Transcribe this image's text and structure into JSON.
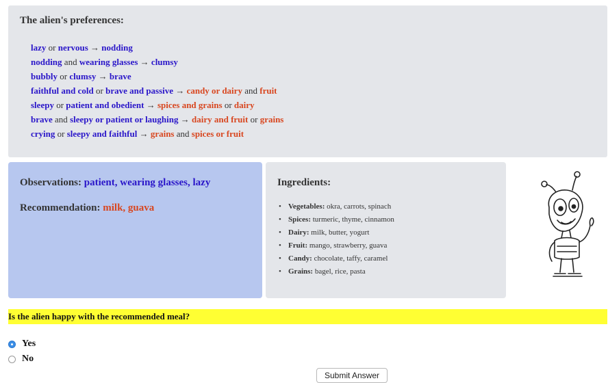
{
  "preferences": {
    "title": "The alien's preferences:",
    "rules": [
      [
        {
          "t": "lazy",
          "c": "blue"
        },
        {
          "t": " or ",
          "c": ""
        },
        {
          "t": "nervous",
          "c": "blue"
        },
        {
          "t": " → ",
          "c": ""
        },
        {
          "t": "nodding",
          "c": "blue"
        }
      ],
      [
        {
          "t": "nodding",
          "c": "blue"
        },
        {
          "t": " and ",
          "c": ""
        },
        {
          "t": "wearing glasses",
          "c": "blue"
        },
        {
          "t": " → ",
          "c": ""
        },
        {
          "t": "clumsy",
          "c": "blue"
        }
      ],
      [
        {
          "t": "bubbly",
          "c": "blue"
        },
        {
          "t": " or ",
          "c": ""
        },
        {
          "t": "clumsy",
          "c": "blue"
        },
        {
          "t": " → ",
          "c": ""
        },
        {
          "t": "brave",
          "c": "blue"
        }
      ],
      [
        {
          "t": "faithful and cold",
          "c": "blue"
        },
        {
          "t": " or ",
          "c": ""
        },
        {
          "t": "brave and passive",
          "c": "blue"
        },
        {
          "t": " → ",
          "c": ""
        },
        {
          "t": "candy or dairy",
          "c": "red"
        },
        {
          "t": " and ",
          "c": ""
        },
        {
          "t": "fruit",
          "c": "red"
        }
      ],
      [
        {
          "t": "sleepy",
          "c": "blue"
        },
        {
          "t": " or ",
          "c": ""
        },
        {
          "t": "patient and obedient",
          "c": "blue"
        },
        {
          "t": " → ",
          "c": ""
        },
        {
          "t": "spices and grains",
          "c": "red"
        },
        {
          "t": " or ",
          "c": ""
        },
        {
          "t": "dairy",
          "c": "red"
        }
      ],
      [
        {
          "t": "brave",
          "c": "blue"
        },
        {
          "t": " and ",
          "c": ""
        },
        {
          "t": "sleepy or patient or laughing",
          "c": "blue"
        },
        {
          "t": " → ",
          "c": ""
        },
        {
          "t": "dairy and fruit",
          "c": "red"
        },
        {
          "t": " or ",
          "c": ""
        },
        {
          "t": "grains",
          "c": "red"
        }
      ],
      [
        {
          "t": "crying",
          "c": "blue"
        },
        {
          "t": " or ",
          "c": ""
        },
        {
          "t": "sleepy and faithful",
          "c": "blue"
        },
        {
          "t": " → ",
          "c": ""
        },
        {
          "t": "grains",
          "c": "red"
        },
        {
          "t": " and ",
          "c": ""
        },
        {
          "t": "spices or fruit",
          "c": "red"
        }
      ]
    ]
  },
  "observations": {
    "label": "Observations:",
    "value": "patient, wearing glasses, lazy",
    "recommendation_label": "Recommendation:",
    "recommendation_value": "milk, guava"
  },
  "ingredients": {
    "title": "Ingredients:",
    "items": [
      {
        "name": "Vegetables:",
        "values": "okra, carrots, spinach"
      },
      {
        "name": "Spices:",
        "values": "turmeric, thyme, cinnamon"
      },
      {
        "name": "Dairy:",
        "values": "milk, butter, yogurt"
      },
      {
        "name": "Fruit:",
        "values": "mango, strawberry, guava"
      },
      {
        "name": "Candy:",
        "values": "chocolate, taffy, caramel"
      },
      {
        "name": "Grains:",
        "values": "bagel, rice, pasta"
      }
    ]
  },
  "question": {
    "text": "Is the alien happy with the recommended meal?",
    "options": [
      {
        "label": "Yes",
        "selected": true
      },
      {
        "label": "No",
        "selected": false
      }
    ]
  },
  "submit_label": "Submit Answer",
  "colors": {
    "condition": "#2a16c9",
    "food": "#d8461f",
    "highlight": "#ffff33",
    "panel_gray": "#e4e6ea",
    "panel_blue": "#b7c7ef"
  }
}
